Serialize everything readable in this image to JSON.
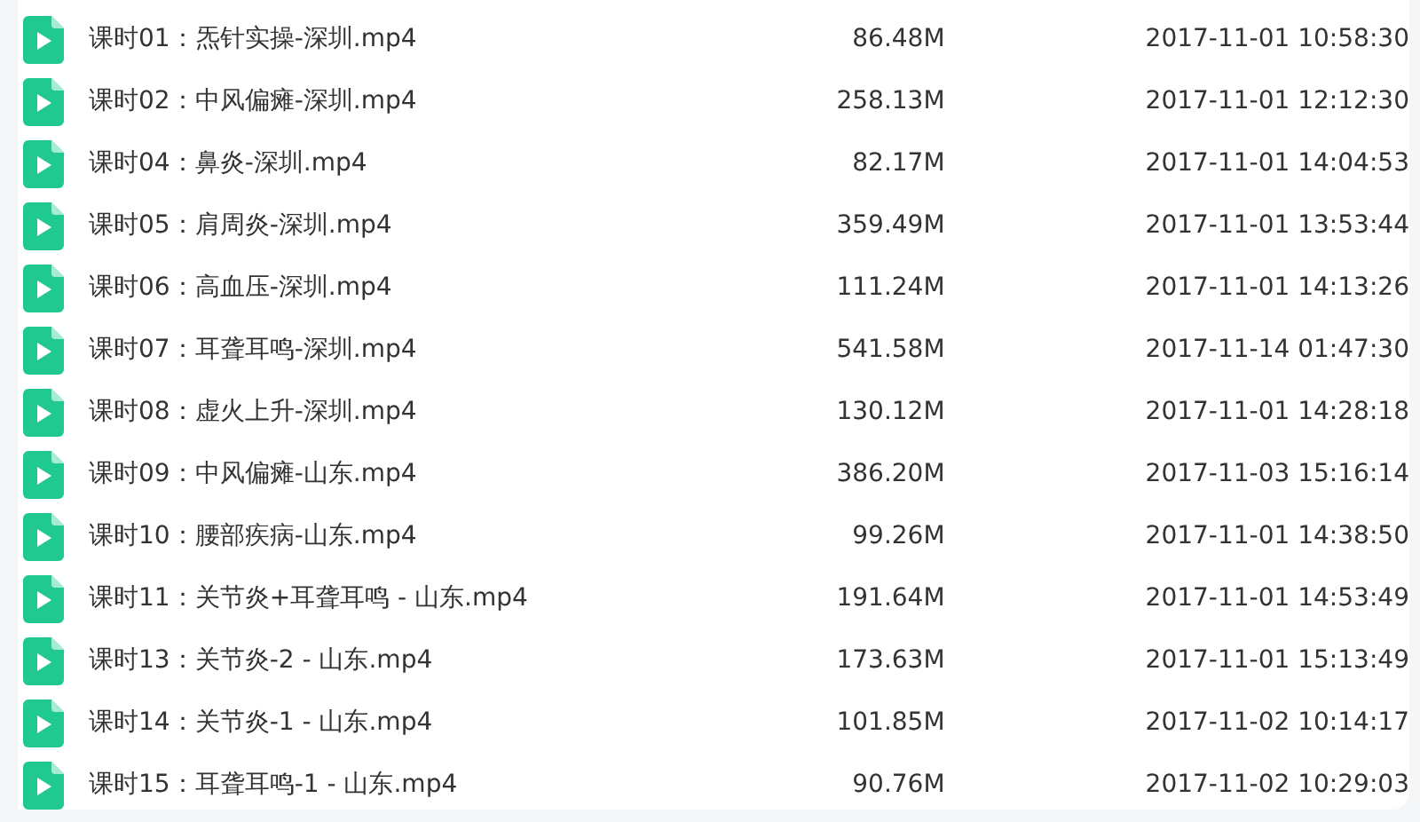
{
  "files": [
    {
      "name": "课时01：炁针实操-深圳.mp4",
      "size": "86.48M",
      "modified": "2017-11-01 10:58:30"
    },
    {
      "name": "课时02：中风偏瘫-深圳.mp4",
      "size": "258.13M",
      "modified": "2017-11-01 12:12:30"
    },
    {
      "name": "课时04：鼻炎-深圳.mp4",
      "size": "82.17M",
      "modified": "2017-11-01 14:04:53"
    },
    {
      "name": "课时05：肩周炎-深圳.mp4",
      "size": "359.49M",
      "modified": "2017-11-01 13:53:44"
    },
    {
      "name": "课时06：高血压-深圳.mp4",
      "size": "111.24M",
      "modified": "2017-11-01 14:13:26"
    },
    {
      "name": "课时07：耳聋耳鸣-深圳.mp4",
      "size": "541.58M",
      "modified": "2017-11-14 01:47:30"
    },
    {
      "name": "课时08：虚火上升-深圳.mp4",
      "size": "130.12M",
      "modified": "2017-11-01 14:28:18"
    },
    {
      "name": "课时09：中风偏瘫-山东.mp4",
      "size": "386.20M",
      "modified": "2017-11-03 15:16:14"
    },
    {
      "name": "课时10：腰部疾病-山东.mp4",
      "size": "99.26M",
      "modified": "2017-11-01 14:38:50"
    },
    {
      "name": "课时11：关节炎+耳聋耳鸣 - 山东.mp4",
      "size": "191.64M",
      "modified": "2017-11-01 14:53:49"
    },
    {
      "name": "课时13：关节炎-2 - 山东.mp4",
      "size": "173.63M",
      "modified": "2017-11-01 15:13:49"
    },
    {
      "name": "课时14：关节炎-1 - 山东.mp4",
      "size": "101.85M",
      "modified": "2017-11-02 10:14:17"
    },
    {
      "name": "课时15：耳聋耳鸣-1 - 山东.mp4",
      "size": "90.76M",
      "modified": "2017-11-02 10:29:03"
    }
  ]
}
